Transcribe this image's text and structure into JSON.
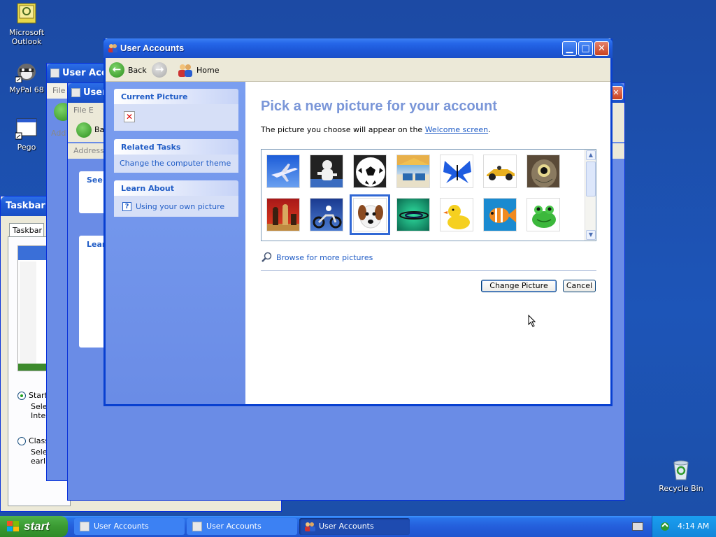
{
  "desktop": {
    "icons": [
      {
        "label": "Microsoft Outlook"
      },
      {
        "label": "MyPal 68"
      },
      {
        "label": "Pego"
      },
      {
        "label": "Recycle Bin"
      }
    ]
  },
  "background_windows": {
    "window1_title": "User Acco",
    "window1_menu": "File",
    "window1_address": "Add",
    "window2_title": "User",
    "window2_menu": "File E",
    "window2_back": "Ba",
    "window2_address": "Address",
    "window2_see": "See",
    "window2_learn": "Lear",
    "taskbar_props_title": "Taskbar a",
    "taskbar_props_tab": "Taskbar",
    "radio_start": "Start",
    "radio_start_desc1": "Selec",
    "radio_start_desc2": "Intern",
    "radio_classic": "Class",
    "radio_classic_desc1": "Selec",
    "radio_classic_desc2": "earlie"
  },
  "window": {
    "title": "User Accounts",
    "toolbar": {
      "back_label": "Back",
      "home_label": "Home"
    },
    "sidebar": {
      "current_picture_header": "Current Picture",
      "related_tasks_header": "Related Tasks",
      "related_tasks_items": [
        "Change the computer theme"
      ],
      "learn_about_header": "Learn About",
      "learn_about_items": [
        "Using your own picture"
      ]
    },
    "content": {
      "heading": "Pick a new picture for your account",
      "subtext_before": "The picture you choose will appear on the ",
      "subtext_link": "Welcome screen",
      "subtext_after": ".",
      "pictures": [
        "airplane",
        "astronaut",
        "soccer-ball",
        "beach-chairs",
        "butterfly",
        "race-car",
        "owl",
        "chess",
        "dirt-bike",
        "dog",
        "aqua-ripple",
        "rubber-duck",
        "fish",
        "frog"
      ],
      "selected_picture": "dog",
      "browse_label": "Browse for more pictures",
      "change_button": "Change Picture",
      "cancel_button": "Cancel"
    }
  },
  "taskbar": {
    "start_label": "start",
    "tasks": [
      "User Accounts",
      "User Accounts",
      "User Accounts"
    ],
    "clock": "4:14 AM"
  }
}
